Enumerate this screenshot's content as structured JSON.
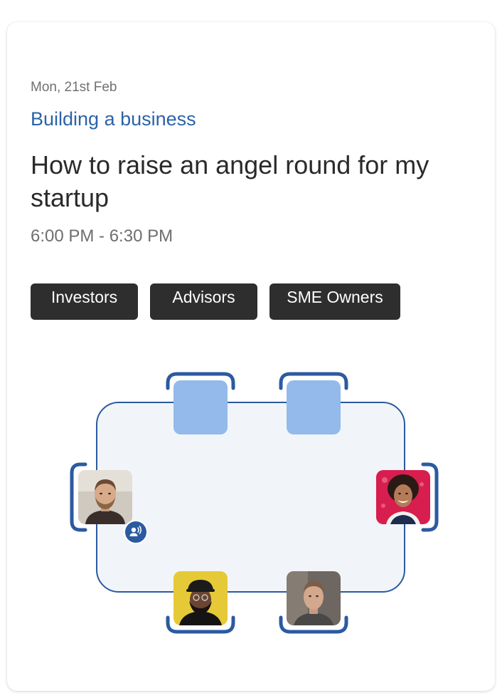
{
  "event": {
    "date": "Mon, 21st Feb",
    "category": "Building a business",
    "title": "How to raise an angel round for my startup",
    "time": "6:00 PM - 6:30 PM"
  },
  "tags": [
    "Investors",
    "Advisors",
    "SME Owners"
  ],
  "table": {
    "seats": [
      {
        "position": "top-1",
        "status": "empty"
      },
      {
        "position": "top-2",
        "status": "empty"
      },
      {
        "position": "left",
        "status": "occupied",
        "speaking": true
      },
      {
        "position": "right",
        "status": "occupied"
      },
      {
        "position": "bottom-1",
        "status": "occupied"
      },
      {
        "position": "bottom-2",
        "status": "occupied"
      }
    ]
  },
  "colors": {
    "accent": "#2b63a8",
    "table_border": "#2b5aa0",
    "empty_seat": "#93baea",
    "tag_bg": "#2e2e2e"
  },
  "icons": {
    "speaker": "speaker-icon"
  }
}
